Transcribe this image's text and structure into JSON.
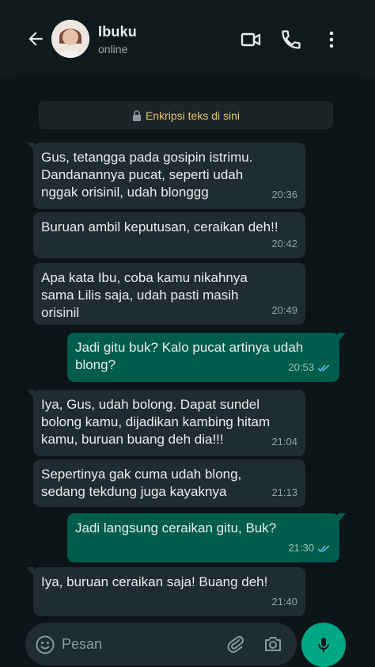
{
  "header": {
    "contact_name": "Ibuku",
    "status": "online"
  },
  "encryption_notice": "Enkripsi teks di sini",
  "messages": [
    {
      "dir": "in",
      "text": "Gus, tetangga pada gosipin istrimu.\nDandanannya pucat, seperti udah\nnggak orisinil, udah blonggg",
      "time": "20:36"
    },
    {
      "dir": "in",
      "text": "Buruan ambil keputusan, ceraikan deh!!",
      "time": "20:42"
    },
    {
      "dir": "in",
      "text": "Apa kata Ibu, coba kamu nikahnya\nsama Lilis saja, udah pasti masih\norisinil",
      "time": "20:49"
    },
    {
      "dir": "out",
      "text": "Jadi gitu buk? Kalo pucat artinya udah\nblong?",
      "time": "20:53"
    },
    {
      "dir": "in",
      "text": "Iya, Gus, udah bolong. Dapat sundel\nbolong kamu, dijadikan kambing hitam\nkamu, buruan buang deh dia!!!",
      "time": "21:04"
    },
    {
      "dir": "in",
      "text": "Sepertinya gak cuma udah blong,\nsedang tekdung juga kayaknya",
      "time": "21:13"
    },
    {
      "dir": "out",
      "text": "Jadi langsung ceraikan gitu, Buk?",
      "time": "21:30"
    },
    {
      "dir": "in",
      "text": "Iya, buruan ceraikan saja! Buang deh!",
      "time": "21:40"
    }
  ],
  "composer": {
    "placeholder": "Pesan"
  },
  "colors": {
    "incoming_bubble": "#1f2c32",
    "outgoing_bubble": "#005c4b",
    "accent": "#00a884",
    "read_ticks": "#53bdeb"
  }
}
